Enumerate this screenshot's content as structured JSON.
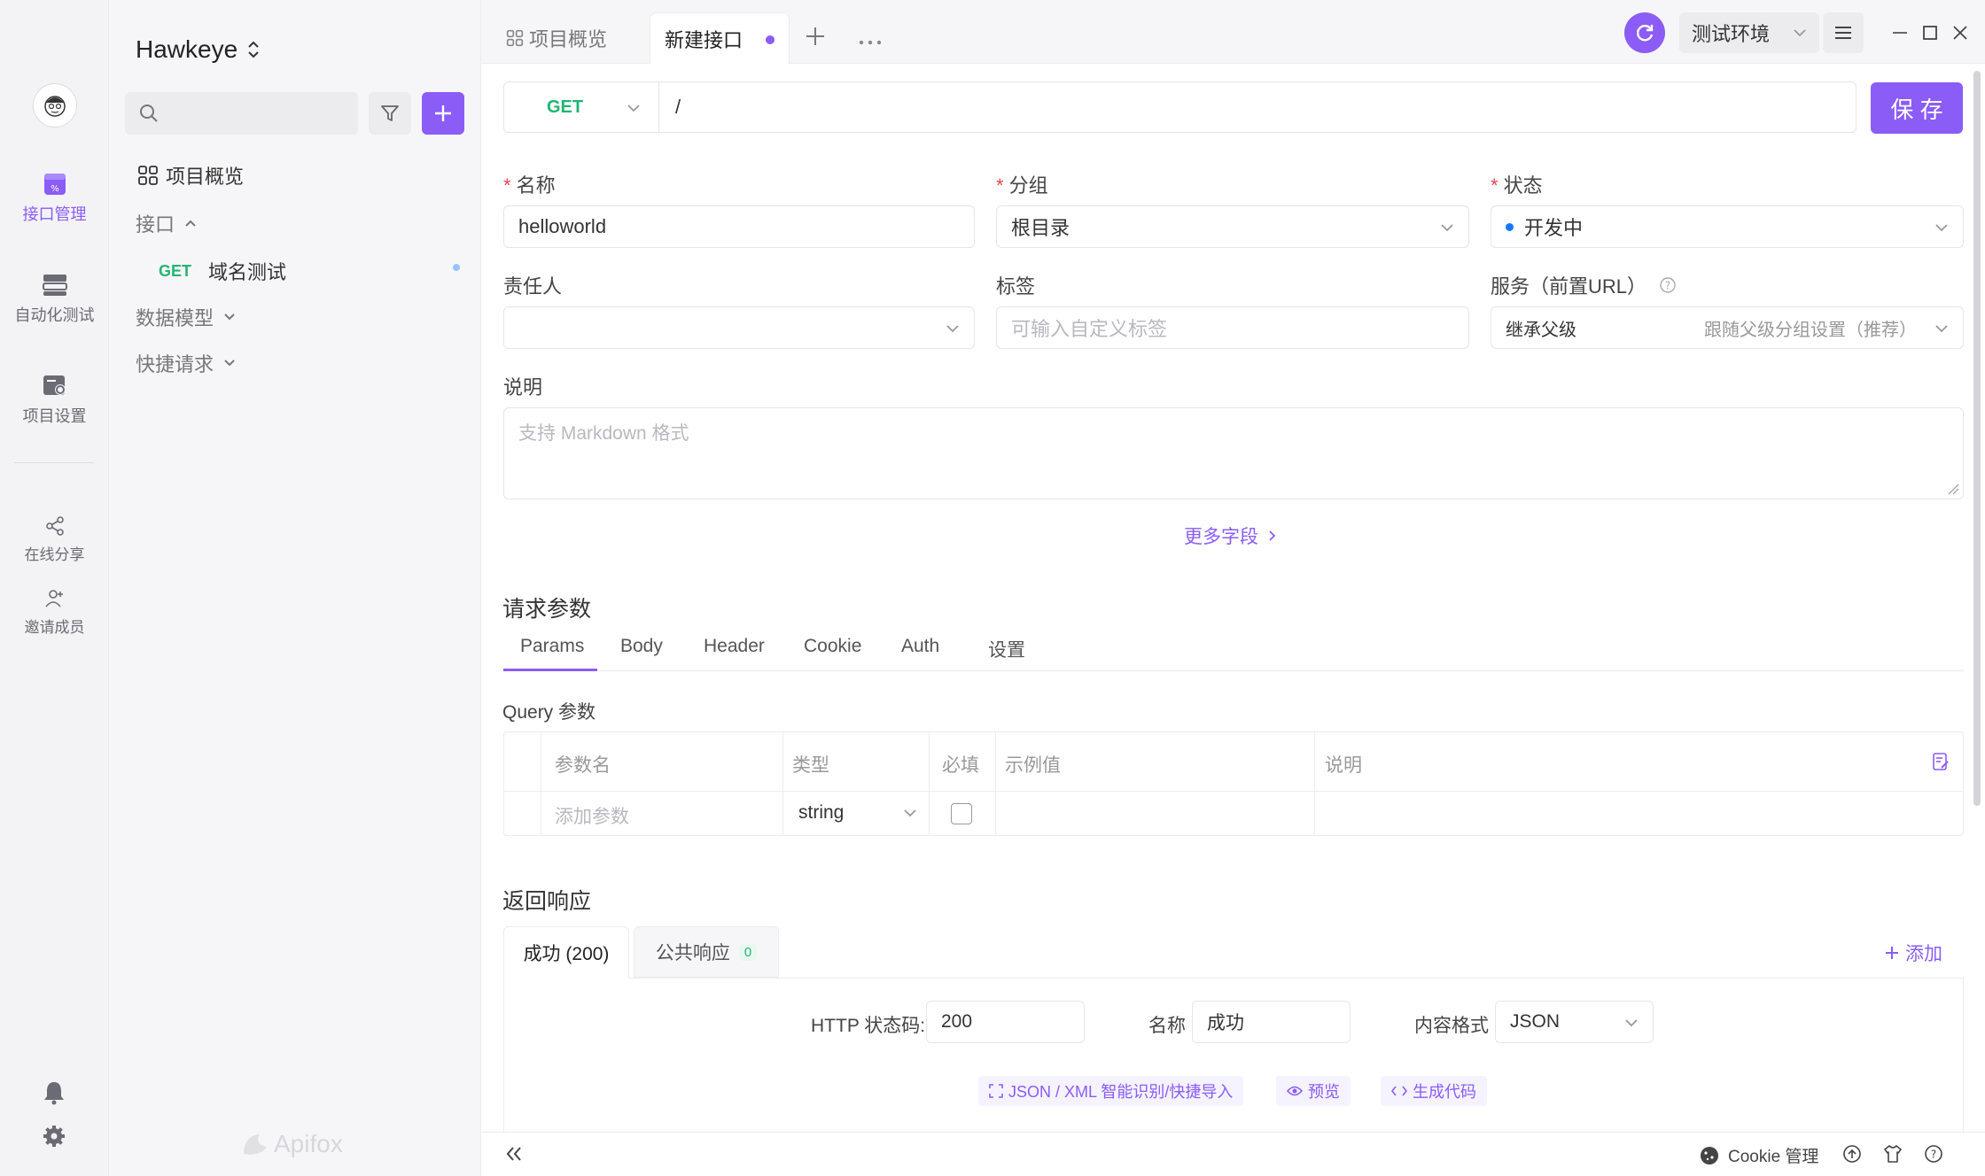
{
  "app": {
    "project_name": "Hawkeye",
    "brand": "Apifox",
    "accent": "#8b5cf6",
    "get_color": "#22b573"
  },
  "rail": {
    "items": [
      {
        "label": "接口管理",
        "icon": "api-icon",
        "active": true
      },
      {
        "label": "自动化测试",
        "icon": "automation-icon",
        "active": false
      },
      {
        "label": "项目设置",
        "icon": "settings-icon",
        "active": false
      },
      {
        "label": "在线分享",
        "icon": "share-icon",
        "active": false
      },
      {
        "label": "邀请成员",
        "icon": "invite-icon",
        "active": false
      }
    ]
  },
  "sidebar": {
    "overview": "项目概览",
    "api_group": "接口",
    "api_item_method": "GET",
    "api_item_name": "域名测试",
    "data_model": "数据模型",
    "quick_request": "快捷请求"
  },
  "tabs": {
    "overview": "项目概览",
    "new_api": "新建接口"
  },
  "env": {
    "name": "测试环境"
  },
  "request": {
    "method": "GET",
    "path": "/",
    "save_label": "保 存"
  },
  "form": {
    "name_label": "名称",
    "name_value": "helloworld",
    "group_label": "分组",
    "group_value": "根目录",
    "status_label": "状态",
    "status_value": "开发中",
    "owner_label": "责任人",
    "tags_label": "标签",
    "tags_placeholder": "可输入自定义标签",
    "service_label": "服务（前置URL）",
    "service_value": "继承父级",
    "service_hint": "跟随父级分组设置（推荐）",
    "desc_label": "说明",
    "desc_placeholder": "支持 Markdown 格式",
    "more_fields": "更多字段"
  },
  "params": {
    "title": "请求参数",
    "tabs": [
      "Params",
      "Body",
      "Header",
      "Cookie",
      "Auth",
      "设置"
    ],
    "query_title": "Query 参数",
    "columns": [
      "参数名",
      "类型",
      "必填",
      "示例值",
      "说明"
    ],
    "row": {
      "name_placeholder": "添加参数",
      "type": "string"
    }
  },
  "response": {
    "title": "返回响应",
    "tab_success": "成功 (200)",
    "tab_public": "公共响应",
    "public_count": "0",
    "add": "添加",
    "status_code_label": "HTTP 状态码:",
    "status_code": "200",
    "name_label": "名称",
    "name_value": "成功",
    "format_label": "内容格式",
    "format_value": "JSON",
    "action_import": "JSON / XML 智能识别/快捷导入",
    "action_preview": "预览",
    "action_codegen": "生成代码"
  },
  "footer": {
    "cookie": "Cookie 管理"
  }
}
